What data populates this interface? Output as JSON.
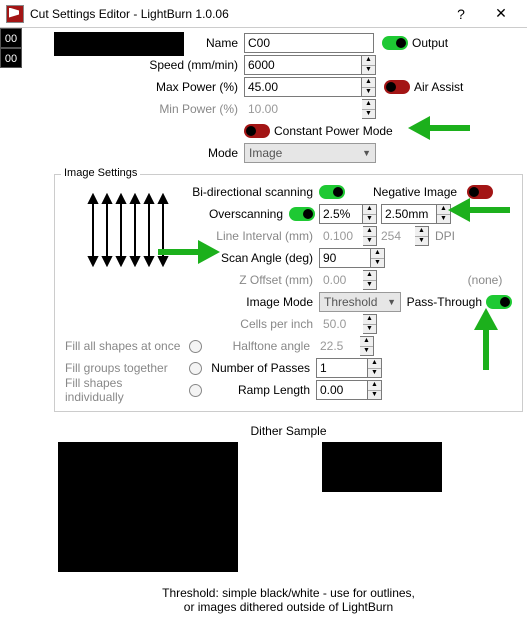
{
  "window": {
    "title": "Cut Settings Editor - LightBurn 1.0.06"
  },
  "layers": [
    "00",
    "00"
  ],
  "top": {
    "name_label": "Name",
    "name_value": "C00",
    "output_label": "Output",
    "speed_label": "Speed (mm/min)",
    "speed_value": "6000",
    "maxpower_label": "Max Power (%)",
    "maxpower_value": "45.00",
    "airassist_label": "Air Assist",
    "minpower_label": "Min Power (%)",
    "minpower_value": "10.00",
    "constant_label": "Constant Power Mode",
    "mode_label": "Mode",
    "mode_value": "Image"
  },
  "image": {
    "legend": "Image Settings",
    "bidir_label": "Bi-directional scanning",
    "negimg_label": "Negative Image",
    "overscan_label": "Overscanning",
    "overscan_pct": "2.5%",
    "overscan_mm": "2.50mm",
    "lineint_label": "Line Interval (mm)",
    "lineint_value": "0.100",
    "dpi_value": "254",
    "dpi_label": "DPI",
    "scanangle_label": "Scan Angle (deg)",
    "scanangle_value": "90",
    "zoffset_label": "Z Offset (mm)",
    "zoffset_value": "0.00",
    "none_label": "(none)",
    "imagemode_label": "Image Mode",
    "imagemode_value": "Threshold",
    "passthrough_label": "Pass-Through",
    "cpi_label": "Cells per inch",
    "cpi_value": "50.0",
    "halftone_label": "Halftone angle",
    "halftone_value": "22.5",
    "fillall_label": "Fill all shapes at once",
    "passes_label": "Number of Passes",
    "passes_value": "1",
    "fillgroups_label": "Fill groups together",
    "ramp_label": "Ramp Length",
    "ramp_value": "0.00",
    "fillshapes_label": "Fill shapes individually"
  },
  "dither": {
    "title": "Dither Sample",
    "footer1": "Threshold: simple black/white - use for outlines,",
    "footer2": "or images dithered outside of LightBurn"
  }
}
